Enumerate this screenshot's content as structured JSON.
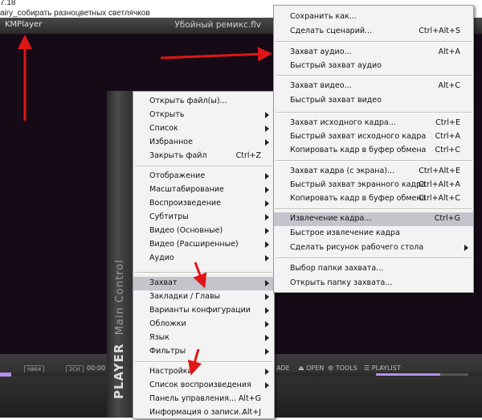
{
  "caption": {
    "line1": "7.18",
    "line2": "airy_собирать разноцветных светлячков"
  },
  "player": {
    "app_name": "KMPlayer",
    "file_name": "Убойный ремикс.flv",
    "badge1": "H864",
    "badge2": "2CH",
    "time": "00:00",
    "right_controls": "ADE",
    "open_label": "OPEN",
    "tools_label": "TOOLS",
    "playlist_label": "PLAYLIST"
  },
  "strip": {
    "brand": "PLAYER",
    "label": "Main Control"
  },
  "main_menu": {
    "items": [
      {
        "label": "Открыть файл(ы)..."
      },
      {
        "label": "Открыть",
        "submenu": true
      },
      {
        "label": "Список",
        "submenu": true
      },
      {
        "label": "Избранное",
        "submenu": true
      },
      {
        "label": "Закрыть файл",
        "shortcut": "Ctrl+Z"
      },
      {
        "label": "Отображение",
        "submenu": true
      },
      {
        "label": "Масштабирование",
        "submenu": true
      },
      {
        "label": "Воспроизведение",
        "submenu": true
      },
      {
        "label": "Субтитры",
        "submenu": true
      },
      {
        "label": "Видео (Основные)",
        "submenu": true
      },
      {
        "label": "Видео (Расширенные)",
        "submenu": true
      },
      {
        "label": "Аудио",
        "submenu": true
      },
      {
        "label": "Захват",
        "submenu": true
      },
      {
        "label": "Закладки / Главы",
        "submenu": true
      },
      {
        "label": "Варианты конфигурации",
        "submenu": true
      },
      {
        "label": "Обложки",
        "submenu": true
      },
      {
        "label": "Язык",
        "submenu": true
      },
      {
        "label": "Фильтры",
        "submenu": true
      },
      {
        "label": "Настройки",
        "submenu": true
      },
      {
        "label": "Список воспроизведения",
        "submenu": true
      },
      {
        "label": "Панель управления...",
        "shortcut": "Alt+G"
      },
      {
        "label": "Информация о записи...",
        "shortcut": "Alt+J"
      }
    ]
  },
  "capture_menu": {
    "items": [
      {
        "label": "Сохранить как..."
      },
      {
        "label": "Сделать сценарий...",
        "shortcut": "Ctrl+Alt+S"
      },
      {
        "label": "Захват аудио...",
        "shortcut": "Alt+A"
      },
      {
        "label": "Быстрый захват аудио"
      },
      {
        "label": "Захват видео...",
        "shortcut": "Alt+C"
      },
      {
        "label": "Быстрый захват видео"
      },
      {
        "label": "Захват исходного кадра...",
        "shortcut": "Ctrl+E"
      },
      {
        "label": "Быстрый захват исходного кадра",
        "shortcut": "Ctrl+A"
      },
      {
        "label": "Копировать кадр в буфер обмена",
        "shortcut": "Ctrl+C"
      },
      {
        "label": "Захват кадра (с экрана)...",
        "shortcut": "Ctrl+Alt+E"
      },
      {
        "label": "Быстрый захват экранного кадра",
        "shortcut": "Ctrl+Alt+A"
      },
      {
        "label": "Копировать кадр в буфер обмена",
        "shortcut": "Ctrl+Alt+C"
      },
      {
        "label": "Извлечение кадра...",
        "shortcut": "Ctrl+G"
      },
      {
        "label": "Быстрое извлечение кадра"
      },
      {
        "label": "Сделать рисунок рабочего стола",
        "submenu": true
      },
      {
        "label": "Выбор папки захвата..."
      },
      {
        "label": "Открыть папку захвата..."
      }
    ]
  },
  "colors": {
    "arrow": "#e01616",
    "highlight": "#c4c4cc",
    "accent": "#b48ef0"
  }
}
